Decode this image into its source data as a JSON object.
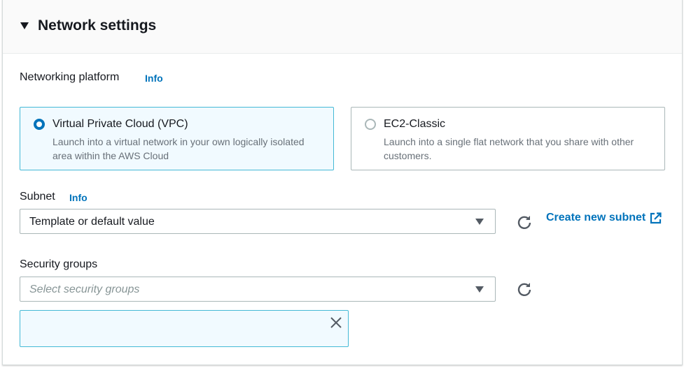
{
  "section": {
    "title": "Network settings"
  },
  "networking_platform": {
    "label": "Networking platform",
    "info": "Info",
    "options": [
      {
        "title": "Virtual Private Cloud (VPC)",
        "description": "Launch into a virtual network in your own logically isolated area within the AWS Cloud",
        "selected": true
      },
      {
        "title": "EC2-Classic",
        "description": "Launch into a single flat network that you share with other customers.",
        "selected": false
      }
    ]
  },
  "subnet": {
    "label": "Subnet",
    "info": "Info",
    "value": "Template or default value",
    "create_link": "Create new subnet"
  },
  "security_groups": {
    "label": "Security groups",
    "placeholder": "Select security groups"
  },
  "colors": {
    "accent": "#0073bb",
    "selected_border": "#44b9d6",
    "selected_bg": "#f1faff"
  }
}
